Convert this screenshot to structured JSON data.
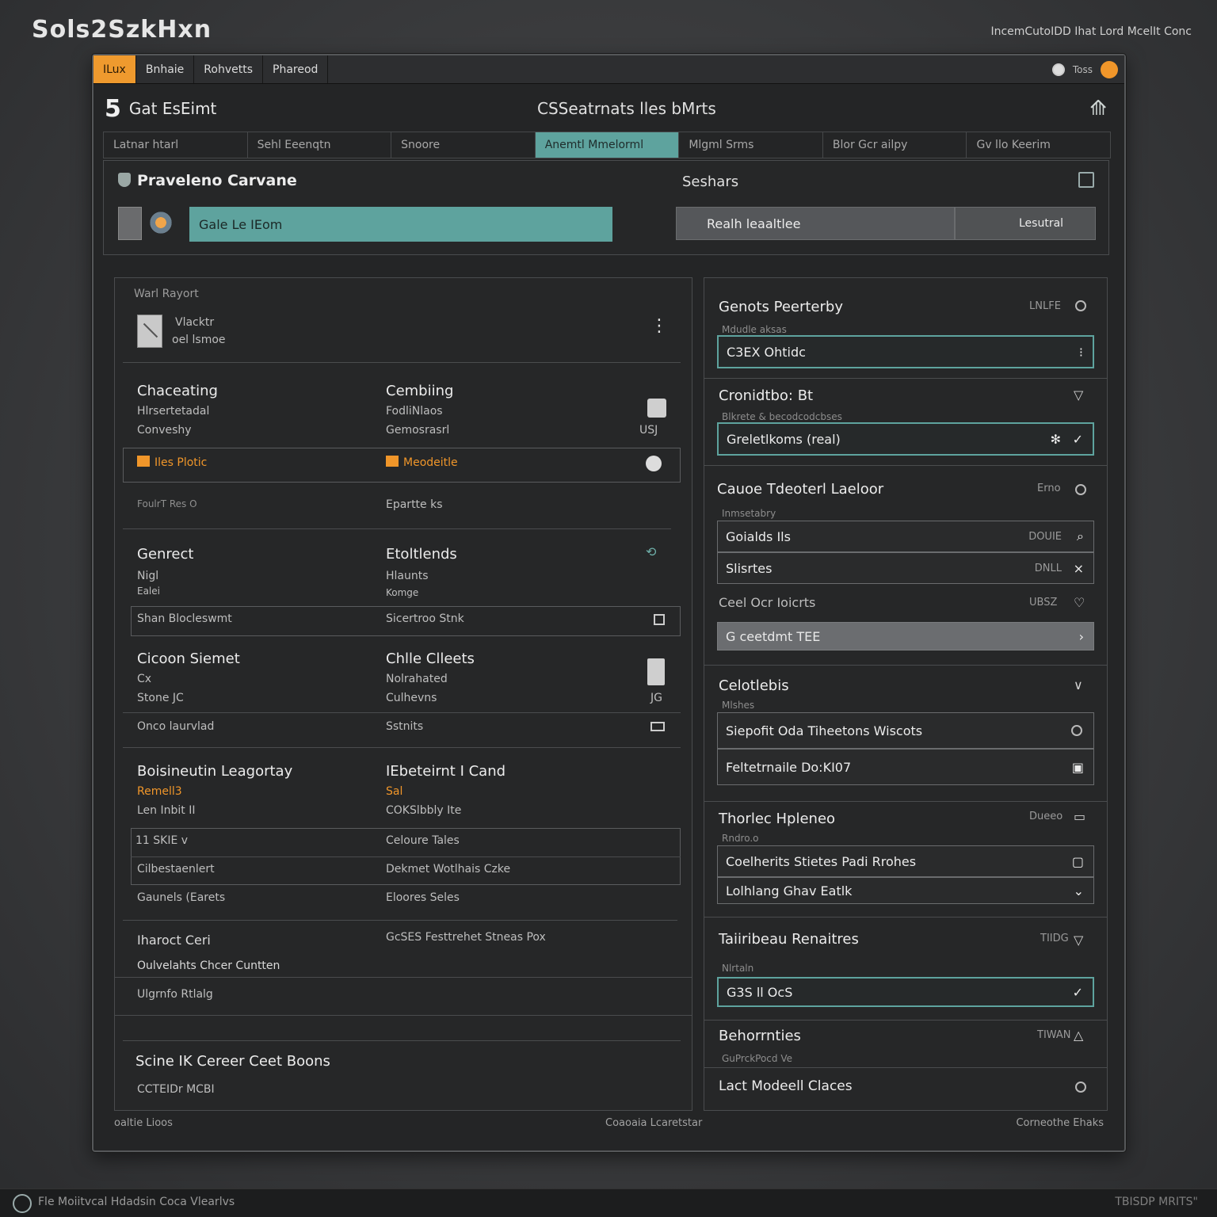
{
  "app": {
    "brand": "Sols2SzkHxn",
    "tagline": "IncemCutoIDD Ihat Lord McelIt Conc"
  },
  "menubar": {
    "items": [
      "ILux",
      "Bnhaie",
      "Rohvetts",
      "Phareod"
    ],
    "active": 0,
    "right_text": "Toss"
  },
  "titlebar": {
    "number": "5",
    "title": "Gat EsEimt",
    "center_title": "CSSeatrnats lles bMrts"
  },
  "tabs": {
    "items": [
      "Latnar htarl",
      "Sehl Eeenqtn",
      "Snoore",
      "Anemtl Mmelorml",
      "Mlgml Srms",
      "Blor Gcr ailpy",
      "Gv llo Keerim"
    ],
    "active": 3
  },
  "hero": {
    "title": "Praveleno Carvane",
    "right_title": "Seshars",
    "input_value": "Gale Le IEom",
    "right_input_value": "Realh leaaltlee",
    "right_button": "Lesutral"
  },
  "left": {
    "header_small": "Warl Rayort",
    "doc_line1": "Vlacktr",
    "doc_line2": "oel lsmoe",
    "sections": [
      {
        "col1": {
          "title": "Chaceating",
          "l1": "Hlrsertetadal",
          "l2": "Conveshy"
        },
        "col2": {
          "title": "Cembiing",
          "l1": "FodliNlaos",
          "l2": "Gemosrasrl"
        },
        "right_label": "USJ"
      },
      {
        "col1_orange": "Iles Plotic",
        "col2_orange": "Meodeitle"
      },
      {
        "col1": "FoulrT Res O",
        "col2": "Epartte ks"
      },
      {
        "col1": {
          "title": "Genrect",
          "l1": "Nigl",
          "l2": "Ealei"
        },
        "col2": {
          "title": "Etoltlends",
          "l1": "Hlaunts",
          "l2": "Komge"
        }
      },
      {
        "col1": "Shan Blocleswmt",
        "col2": "Sicertroo Stnk"
      },
      {
        "col1": {
          "title": "Cicoon Siemet",
          "l1": "Cx",
          "l2": "Stone  JC"
        },
        "col2": {
          "title": "Chlle Clleets",
          "l1": "Nolrahated",
          "l2": "Culhevns"
        },
        "right_label": "JG"
      },
      {
        "col1": "Onco laurvlad",
        "col2": "Sstnits"
      },
      {
        "col1": {
          "title": "Boisineutin Leagortay",
          "l1": "Remell3",
          "l2": "Len Inbit II"
        },
        "col2": {
          "title": "IEbeteirnt I Cand",
          "l1": "Sal",
          "l2": "COKSlbbly Ite"
        }
      },
      {
        "col1": "11 SKIE  v",
        "col2": "Celoure Tales"
      },
      {
        "col1": "Cilbestaenlert",
        "col2": "Dekmet Wotlhais Czke"
      },
      {
        "col1": "Gaunels (Earets",
        "col2": "Eloores Seles"
      },
      {
        "col1": "Iharoct Ceri",
        "col2": "GcSES Festtrehet Stneas Pox"
      },
      {
        "col1": "Oulvelahts Chcer Cuntten"
      },
      {
        "col1": "Ulgrnfo Rtlalg"
      }
    ],
    "bottom_title": "Scine IK Cereer Ceet Boons",
    "bottom_sub": "CCTEIDr MCBI"
  },
  "right": {
    "blocks": [
      {
        "title": "Genots Peerterby",
        "meta": "LNLFE",
        "sub": "Mdudle aksas",
        "field": "C3EX Ohtidc"
      },
      {
        "title": "Cronidtbo: Bt",
        "sub": "Blkrete & becodcodcbses",
        "field": "Greletlkoms (real)"
      },
      {
        "title": "Cauoe Tdeoterl Laeloor",
        "meta": "Erno",
        "sub": "Inmsetabry",
        "rows": [
          {
            "label": "Goialds Ils",
            "meta": "DOUIE"
          },
          {
            "label": "Slisrtes",
            "meta": "DNLL"
          }
        ]
      },
      {
        "title": "Ceel Ocr Ioicrts",
        "meta": "UBSZ",
        "field": "G ceetdmt TEE"
      },
      {
        "title": "Celotlebis",
        "sub": "Mlshes",
        "rows": [
          {
            "label": "Siepofit Oda Tiheetons Wiscots"
          },
          {
            "label": "Feltetrnaile Do:KI07"
          }
        ]
      },
      {
        "title": "Thorlec Hpleneo",
        "meta": "Dueeo",
        "sub": "Rndro.o",
        "rows": [
          {
            "label": "Coelherits Stietes Padi Rrohes"
          },
          {
            "label": "Lolhlang Ghav Eatlk"
          }
        ]
      },
      {
        "title": "Taiiribeau Renaitres",
        "meta": "TIIDG",
        "sub": "Nlrtaln",
        "field": "G3S ll OcS"
      },
      {
        "title": "Behorrnties",
        "meta": "TIWAN",
        "sub": "GuPrckPocd Ve",
        "row": "Lact Modeell Claces"
      }
    ]
  },
  "statusbar": {
    "left": "oaltie Lioos",
    "center": "Coaoaia Lcaretstar",
    "right": "Corneothe Ehaks"
  },
  "footer": {
    "text": "Fle Moiitvcal Hdadsin Coca Vlearlvs",
    "right": "TBISDP MRITS\""
  },
  "colors": {
    "accent_orange": "#f0962a",
    "accent_teal": "#5ea39e",
    "background": "#3a3b3d"
  }
}
